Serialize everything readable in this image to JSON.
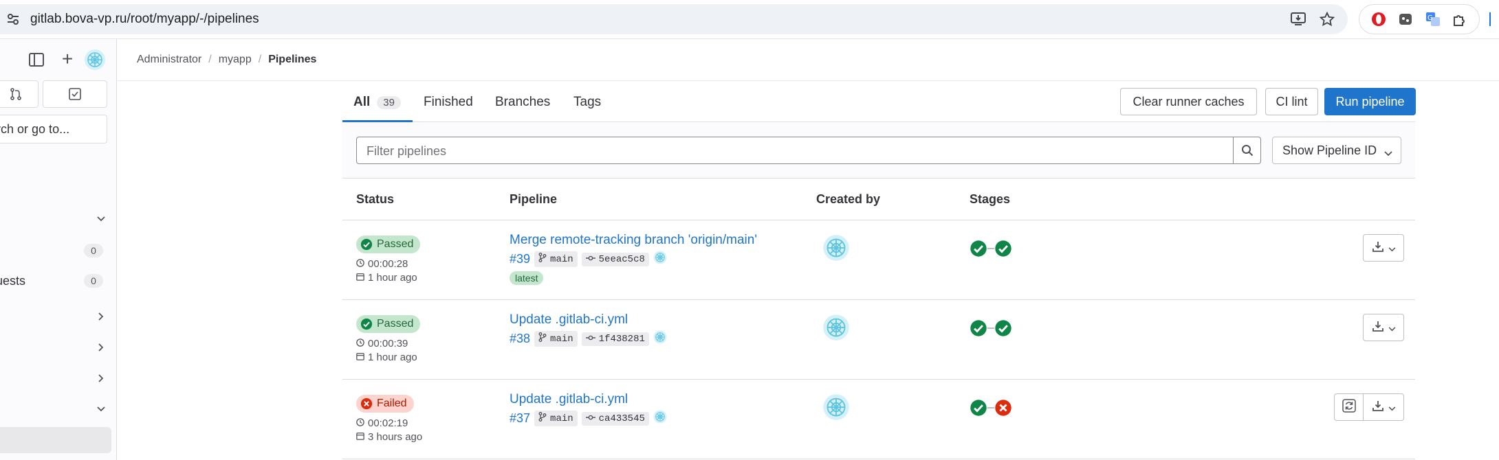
{
  "browser": {
    "url": "gitlab.bova-vp.ru/root/myapp/-/pipelines"
  },
  "sidebar": {
    "search_placeholder": "Search or go to...",
    "items": [
      {
        "label": "",
        "chevron": "down"
      },
      {
        "label": "",
        "count": "0"
      },
      {
        "label": "Merge requests",
        "count": "0"
      },
      {
        "label": "",
        "chevron": "right"
      },
      {
        "label": "",
        "chevron": "right"
      },
      {
        "label": "",
        "chevron": "right"
      },
      {
        "label": "",
        "chevron": "down"
      }
    ]
  },
  "breadcrumb": {
    "items": [
      "Administrator",
      "myapp",
      "Pipelines"
    ]
  },
  "tabs": [
    {
      "label": "All",
      "count": "39"
    },
    {
      "label": "Finished"
    },
    {
      "label": "Branches"
    },
    {
      "label": "Tags"
    }
  ],
  "actions": {
    "clear_caches": "Clear runner caches",
    "ci_lint": "CI lint",
    "run_pipeline": "Run pipeline"
  },
  "filter": {
    "placeholder": "Filter pipelines",
    "show_id": "Show Pipeline ID"
  },
  "table": {
    "headers": [
      "Status",
      "Pipeline",
      "Created by",
      "Stages"
    ],
    "rows": [
      {
        "status": "Passed",
        "duration": "00:00:28",
        "age": "1 hour ago",
        "title": "Merge remote-tracking branch 'origin/main'",
        "id": "#39",
        "branch": "main",
        "commit": "5eeac5c8",
        "tag": "latest",
        "stages": [
          "success",
          "success"
        ],
        "retry": false
      },
      {
        "status": "Passed",
        "duration": "00:00:39",
        "age": "1 hour ago",
        "title": "Update .gitlab-ci.yml",
        "id": "#38",
        "branch": "main",
        "commit": "1f438281",
        "stages": [
          "success",
          "success"
        ],
        "retry": false
      },
      {
        "status": "Failed",
        "duration": "00:02:19",
        "age": "3 hours ago",
        "title": "Update .gitlab-ci.yml",
        "id": "#37",
        "branch": "main",
        "commit": "ca433545",
        "stages": [
          "success",
          "failed"
        ],
        "retry": true
      }
    ]
  },
  "colors": {
    "accent": "#1f75cb",
    "success": "#108548",
    "failed": "#dd2b0e"
  }
}
